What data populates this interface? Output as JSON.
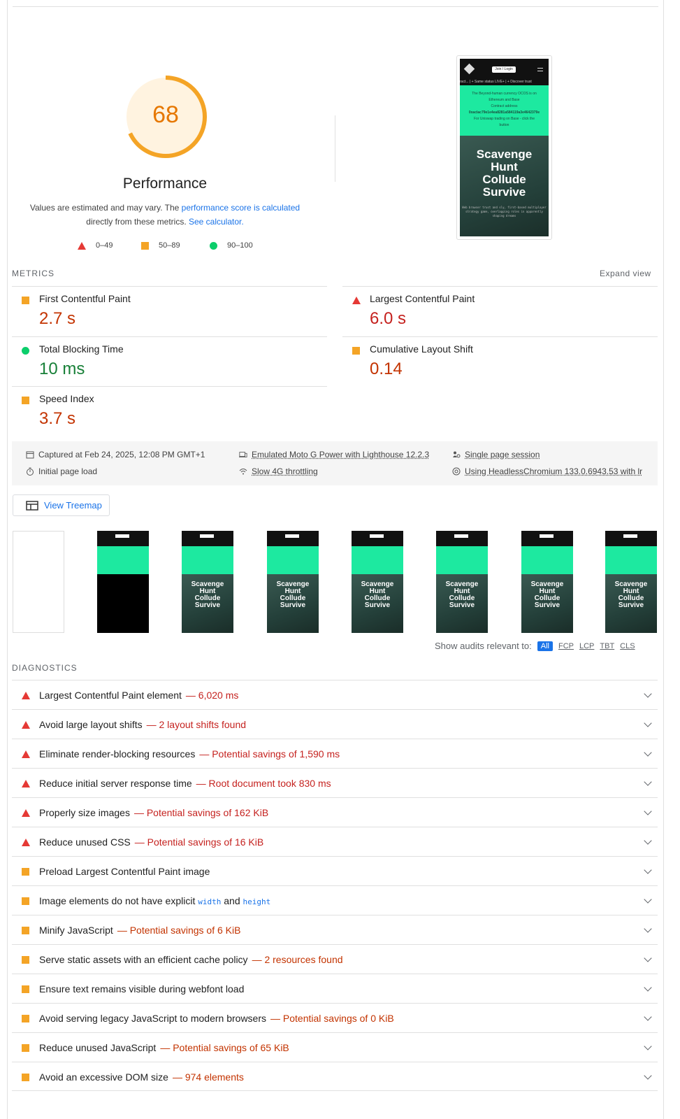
{
  "performance": {
    "score": "68",
    "title": "Performance",
    "desc_prefix": "Values are estimated and may vary. The ",
    "desc_link1": "performance score is calculated",
    "desc_mid": "directly from these metrics. ",
    "desc_link2": "See calculator.",
    "legend": {
      "fail": "0–49",
      "average": "50–89",
      "pass": "90–100"
    },
    "colors": {
      "score": "#f4a426",
      "fail": "#e53935",
      "average": "#f4a426",
      "pass": "#0cce6b"
    }
  },
  "screenshot": {
    "pill": "Join / Login",
    "ticker": "ract... | + Same status LIVE+ | + Discover trust",
    "green_lines": [
      "The Beyond-human currency OCOS is on",
      "Ethereum and Base",
      "Contract address",
      "0xaclac79e1e4ea8281a584119a3e4642379e",
      "For Uniswap trading on Base - click the",
      "button"
    ],
    "hero": [
      "Scavenge",
      "Hunt",
      "Collude",
      "Survive"
    ],
    "hero_small": "Web browser trust and sly, first-based multiplayer strategy game, overlapping roles in apparently shaping dreams"
  },
  "metrics": {
    "label": "METRICS",
    "expand": "Expand view",
    "items": [
      {
        "name": "First Contentful Paint",
        "value": "2.7 s"
      },
      {
        "name": "Largest Contentful Paint",
        "value": "6.0 s"
      },
      {
        "name": "Total Blocking Time",
        "value": "10 ms"
      },
      {
        "name": "Cumulative Layout Shift",
        "value": "0.14"
      },
      {
        "name": "Speed Index",
        "value": "3.7 s"
      }
    ]
  },
  "info": {
    "captured": "Captured at Feb 24, 2025, 12:08 PM GMT+1",
    "initial": "Initial page load",
    "device": "Emulated Moto G Power with Lighthouse 12.2.3",
    "throttle": "Slow 4G throttling",
    "session": "Single page session",
    "browser": "Using HeadlessChromium 133.0.6943.53 with lr"
  },
  "treemap": {
    "label": "View Treemap"
  },
  "filmstrip": {
    "hero": [
      "Scavenge",
      "Hunt",
      "Collude",
      "Survive"
    ]
  },
  "filter": {
    "label": "Show audits relevant to:",
    "chips": [
      "All",
      "FCP",
      "LCP",
      "TBT",
      "CLS"
    ]
  },
  "diagnostics": {
    "label": "DIAGNOSTICS",
    "items": [
      {
        "title": "Largest Contentful Paint element",
        "sub": "— 6,020 ms"
      },
      {
        "title": "Avoid large layout shifts",
        "sub": "— 2 layout shifts found"
      },
      {
        "title": "Eliminate render-blocking resources",
        "sub": "— Potential savings of 1,590 ms"
      },
      {
        "title": "Reduce initial server response time",
        "sub": "— Root document took 830 ms"
      },
      {
        "title": "Properly size images",
        "sub": "— Potential savings of 162 KiB"
      },
      {
        "title": "Reduce unused CSS",
        "sub": "— Potential savings of 16 KiB"
      },
      {
        "title": "Preload Largest Contentful Paint image",
        "sub": ""
      },
      {
        "title": "Image elements do not have explicit ",
        "code1": "width",
        "mid": " and ",
        "code2": "height"
      },
      {
        "title": "Minify JavaScript",
        "sub": "— Potential savings of 6 KiB"
      },
      {
        "title": "Serve static assets with an efficient cache policy",
        "sub": "— 2 resources found"
      },
      {
        "title": "Ensure text remains visible during webfont load",
        "sub": ""
      },
      {
        "title": "Avoid serving legacy JavaScript to modern browsers",
        "sub": "— Potential savings of 0 KiB"
      },
      {
        "title": "Reduce unused JavaScript",
        "sub": "— Potential savings of 65 KiB"
      },
      {
        "title": "Avoid an excessive DOM size",
        "sub": "— 974 elements"
      }
    ]
  }
}
